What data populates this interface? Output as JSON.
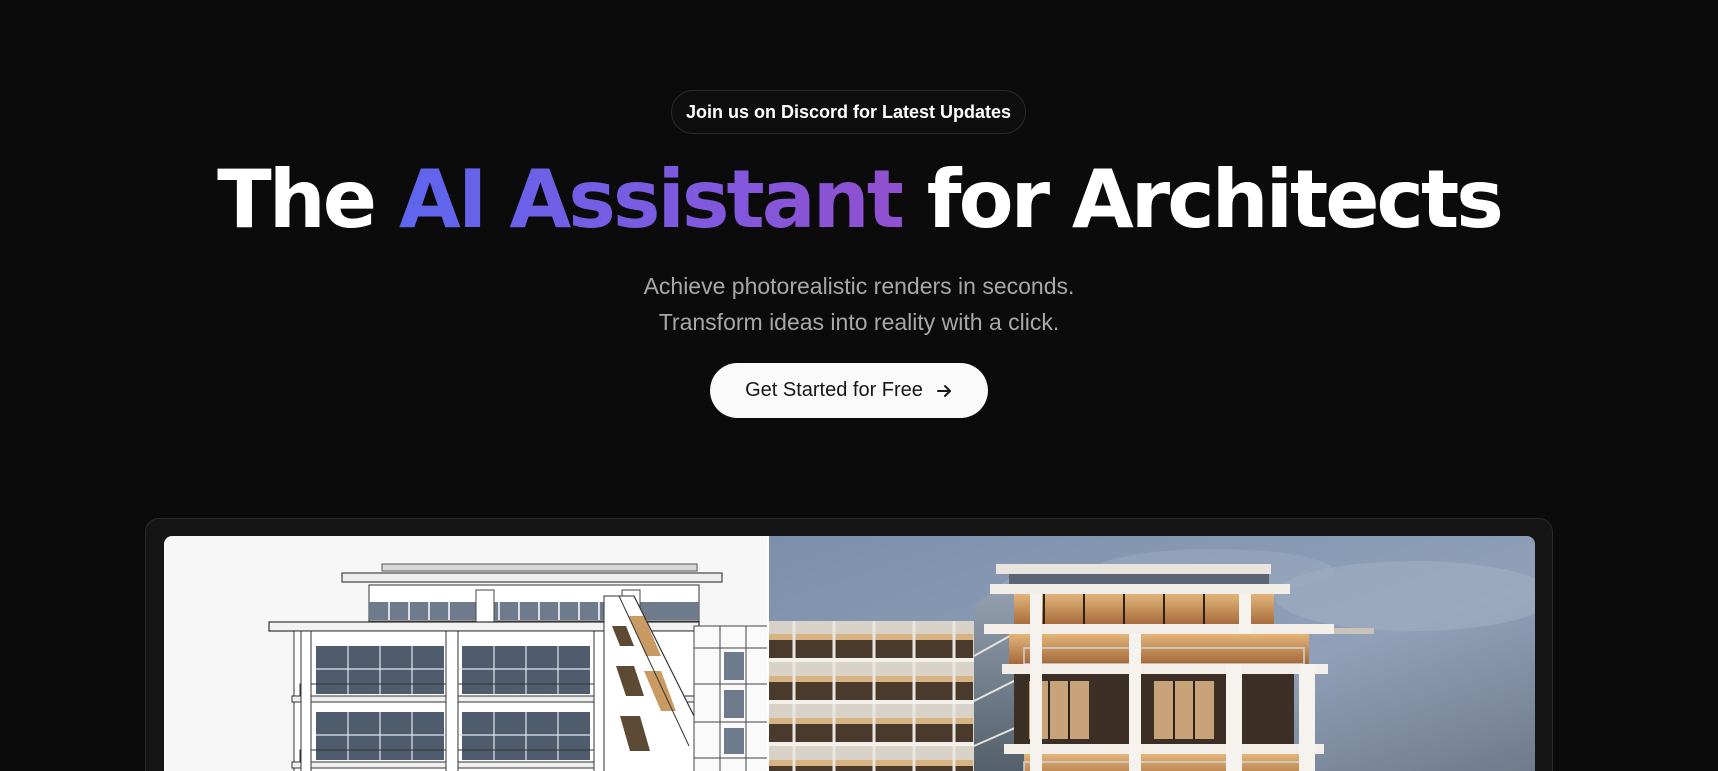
{
  "announcement": {
    "label": "Join us on Discord for Latest Updates"
  },
  "hero": {
    "title_prefix": "The ",
    "title_highlight": "AI Assistant",
    "title_suffix": " for Architects",
    "subtitle_line1": "Achieve photorealistic renders in seconds.",
    "subtitle_line2": "Transform ideas into reality with a click.",
    "cta_label": "Get Started for Free",
    "cta_icon": "arrow-right-icon"
  },
  "colors": {
    "background": "#0b0b0b",
    "accent_start": "#5e66ee",
    "accent_end": "#9150cf",
    "subtitle": "#a8a8a8",
    "cta_background": "#fafafa"
  },
  "comparison": {
    "left": "sketch-render",
    "right": "photorealistic-render"
  }
}
